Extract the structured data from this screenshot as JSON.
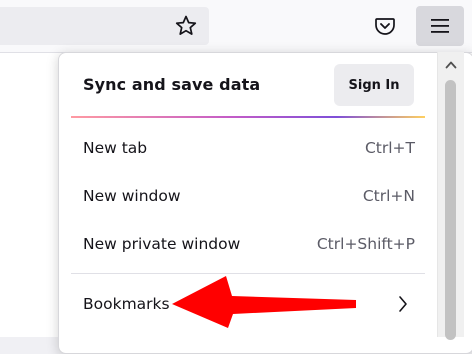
{
  "toolbar": {
    "star_icon": "star-icon",
    "pocket_icon": "pocket-icon",
    "menu_icon": "hamburger-menu-icon"
  },
  "app_menu": {
    "sync_title": "Sync and save data",
    "sign_in_label": "Sign In",
    "items": [
      {
        "label": "New tab",
        "shortcut": "Ctrl+T"
      },
      {
        "label": "New window",
        "shortcut": "Ctrl+N"
      },
      {
        "label": "New private window",
        "shortcut": "Ctrl+Shift+P"
      }
    ],
    "bookmarks_label": "Bookmarks",
    "bookmarks_icon": "chevron-right-icon"
  },
  "annotation": {
    "arrow_color": "#ff0000"
  },
  "colors": {
    "toolbar_bg": "#f9f9fb",
    "menu_button_bg": "#d8d8dd",
    "signin_bg": "#ececef",
    "text": "#15141a"
  }
}
